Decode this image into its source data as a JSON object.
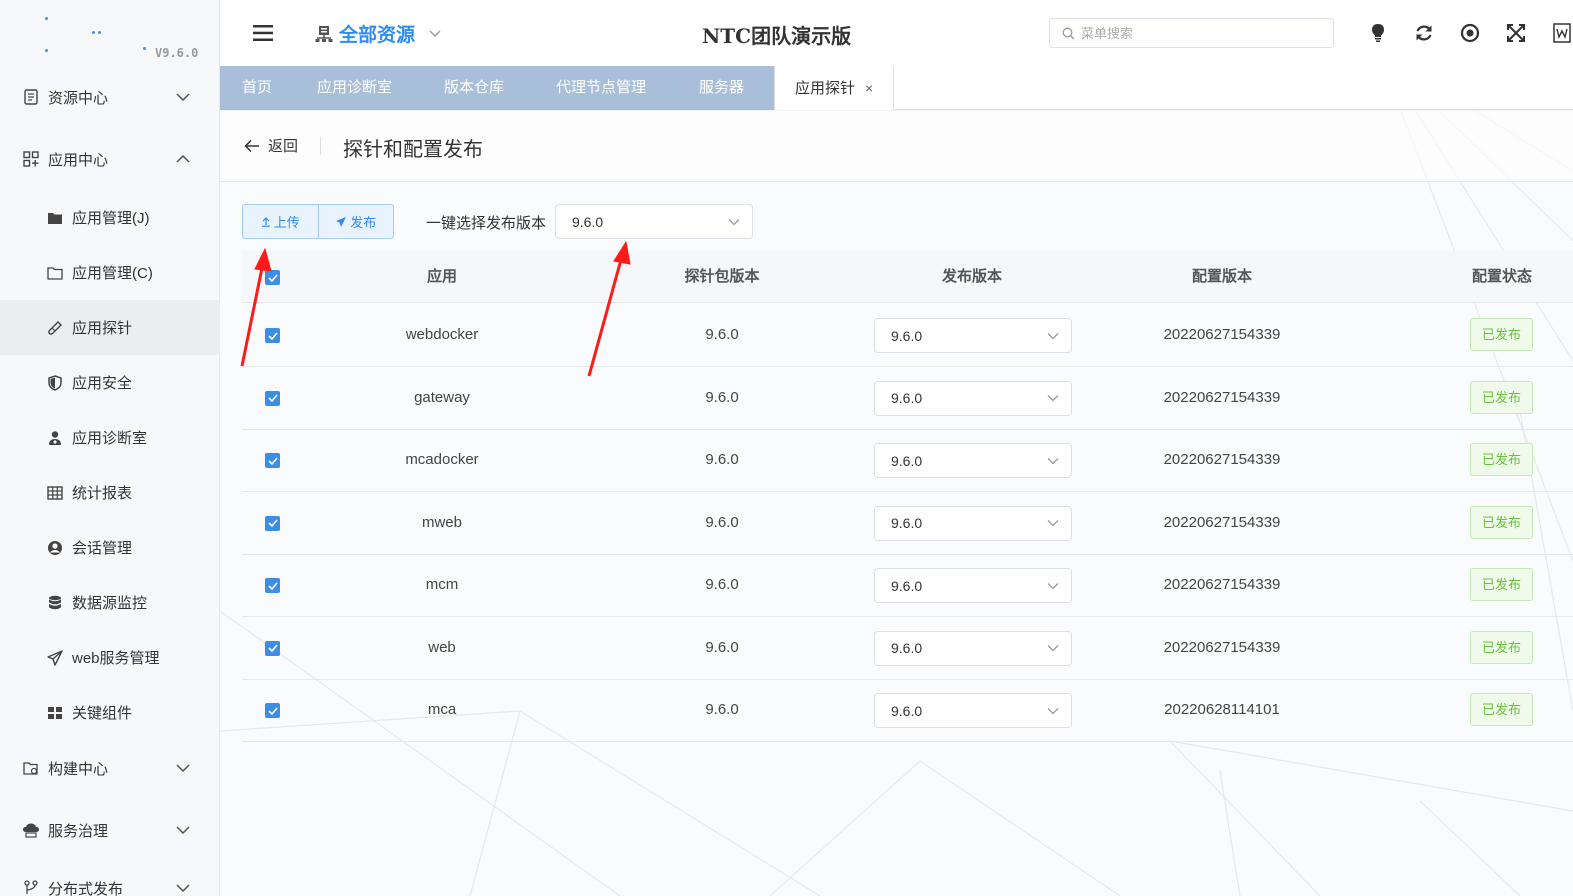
{
  "sidebar": {
    "version": "V9.6.0",
    "items": [
      {
        "label": "资源中心",
        "icon": "document-icon"
      },
      {
        "label": "应用中心",
        "icon": "grid-icon"
      },
      {
        "label": "应用管理(J)",
        "icon": "folder-filled-icon"
      },
      {
        "label": "应用管理(C)",
        "icon": "folder-outline-icon"
      },
      {
        "label": "应用探针",
        "icon": "probe-icon"
      },
      {
        "label": "应用安全",
        "icon": "shield-icon"
      },
      {
        "label": "应用诊断室",
        "icon": "doctor-icon"
      },
      {
        "label": "统计报表",
        "icon": "table-icon"
      },
      {
        "label": "会话管理",
        "icon": "user-icon"
      },
      {
        "label": "数据源监控",
        "icon": "database-icon"
      },
      {
        "label": "web服务管理",
        "icon": "send-icon"
      },
      {
        "label": "关键组件",
        "icon": "components-icon"
      },
      {
        "label": "构建中心",
        "icon": "build-icon"
      },
      {
        "label": "服务治理",
        "icon": "cloud-icon"
      },
      {
        "label": "分布式发布",
        "icon": "branch-icon"
      }
    ]
  },
  "header": {
    "resource_label": "全部资源",
    "title": "NTC团队演示版",
    "search_placeholder": "菜单搜索"
  },
  "tabs": [
    {
      "label": "首页"
    },
    {
      "label": "应用诊断室"
    },
    {
      "label": "版本仓库"
    },
    {
      "label": "代理节点管理"
    },
    {
      "label": "服务器"
    },
    {
      "label": "应用探针",
      "close": "×"
    }
  ],
  "page": {
    "back_label": "返回",
    "title": "探针和配置发布",
    "upload_label": "上传",
    "publish_label": "发布",
    "onekey_label": "一键选择发布版本",
    "onekey_value": "9.6.0"
  },
  "table": {
    "headers": {
      "app": "应用",
      "probe_version": "探针包版本",
      "publish_version": "发布版本",
      "config_version": "配置版本",
      "config_status": "配置状态"
    },
    "rows": [
      {
        "app": "webdocker",
        "probe_version": "9.6.0",
        "publish_version": "9.6.0",
        "config_version": "20220627154339",
        "status": "已发布"
      },
      {
        "app": "gateway",
        "probe_version": "9.6.0",
        "publish_version": "9.6.0",
        "config_version": "20220627154339",
        "status": "已发布"
      },
      {
        "app": "mcadocker",
        "probe_version": "9.6.0",
        "publish_version": "9.6.0",
        "config_version": "20220627154339",
        "status": "已发布"
      },
      {
        "app": "mweb",
        "probe_version": "9.6.0",
        "publish_version": "9.6.0",
        "config_version": "20220627154339",
        "status": "已发布"
      },
      {
        "app": "mcm",
        "probe_version": "9.6.0",
        "publish_version": "9.6.0",
        "config_version": "20220627154339",
        "status": "已发布"
      },
      {
        "app": "web",
        "probe_version": "9.6.0",
        "publish_version": "9.6.0",
        "config_version": "20220627154339",
        "status": "已发布"
      },
      {
        "app": "mca",
        "probe_version": "9.6.0",
        "publish_version": "9.6.0",
        "config_version": "20220628114101",
        "status": "已发布"
      }
    ]
  },
  "colors": {
    "accent": "#2f8cf2",
    "tab_bar": "#a9bfd9",
    "success": "#67c23a",
    "annotation": "#ff1a1a"
  }
}
